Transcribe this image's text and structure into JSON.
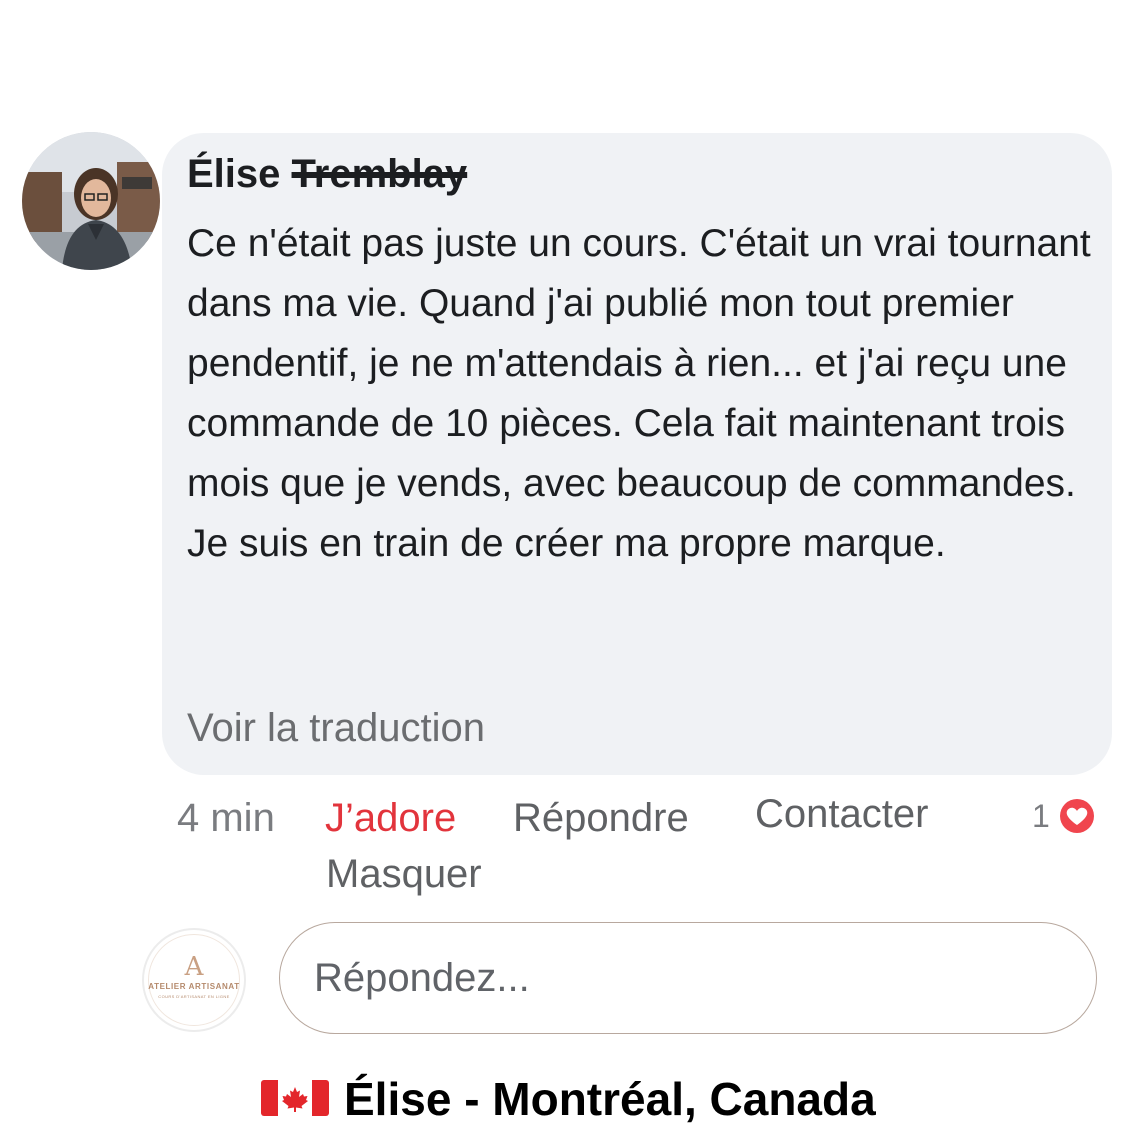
{
  "comment": {
    "author_first": "Élise",
    "author_last": "Tremblay",
    "text": "Ce n'était pas juste un cours. C'était un vrai tournant dans ma vie. Quand j'ai publié mon tout premier pendentif, je ne m'attendais à rien... et j'ai reçu une commande de 10 pièces. Cela fait maintenant trois mois que je vends, avec beaucoup de commandes. Je suis en train de créer ma propre marque.",
    "translate_label": "Voir la traduction"
  },
  "actions": {
    "time": "4 min",
    "love_label": "J’adore",
    "reply_label": "Répondre",
    "contact_label": "Contacter",
    "hide_label": "Masquer",
    "reaction_count": "1",
    "reaction_icon": "heart-icon"
  },
  "reply_box": {
    "placeholder": "Répondez...",
    "page_monogram": "A",
    "page_name": "ATELIER ARTISANAT",
    "page_tagline": "COURS D'ARTISANAT EN LIGNE"
  },
  "footer": {
    "flag_icon": "canada-flag-icon",
    "caption": "Élise - Montréal, Canada"
  },
  "colors": {
    "bubble": "#f0f2f5",
    "love": "#e2343c",
    "brand": "#c9a083"
  }
}
